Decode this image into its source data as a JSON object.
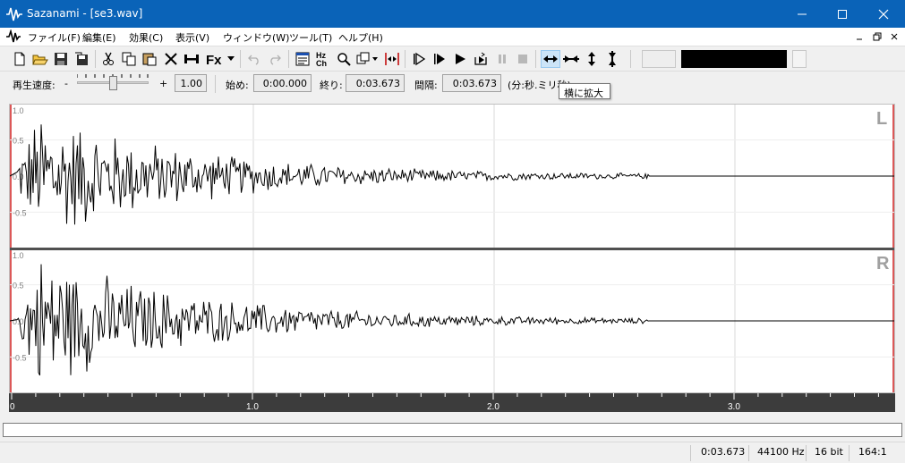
{
  "window": {
    "title": "Sazanami - [se3.wav]"
  },
  "menu": {
    "items": [
      "ファイル(F)",
      "編集(E)",
      "効果(C)",
      "表示(V)",
      "ウィンドウ(W)",
      "ツール(T)",
      "ヘルプ(H)"
    ]
  },
  "toolbar": {
    "icons": [
      "new-file-icon",
      "open-folder-icon",
      "save-icon",
      "save-as-icon",
      "cut-icon",
      "copy-icon",
      "paste-icon",
      "delete-icon",
      "trim-icon",
      "effects-fx-icon",
      "dropdown-arrow-icon",
      "undo-icon",
      "redo-icon",
      "properties-icon",
      "sample-rate-channel-icon",
      "zoom-icon",
      "mix-icon",
      "select-range-icon",
      "play-from-start-icon",
      "play-selection-icon",
      "play-icon",
      "loop-play-icon",
      "pause-icon",
      "stop-icon",
      "zoom-horizontal-in-icon",
      "zoom-horizontal-out-icon",
      "zoom-vertical-in-icon",
      "zoom-vertical-out-icon"
    ],
    "colors": {
      "box1": "#eeeeee",
      "box2": "#000000",
      "box3": "#f4f4f4"
    }
  },
  "range": {
    "speed_label": "再生速度:",
    "speed_minus": "-",
    "speed_plus": "+",
    "speed_value": "1.00",
    "start_label": "始め:",
    "start_value": "0:00.000",
    "end_label": "終り:",
    "end_value": "0:03.673",
    "interval_label": "間隔:",
    "interval_value": "0:03.673",
    "unit_label": "(分:秒.ミリ秒)"
  },
  "tooltip": {
    "text": "横に拡大"
  },
  "waveform": {
    "channels": [
      {
        "name": "L",
        "ticks": [
          "1.0",
          "0.5",
          "0.0",
          "-0.5"
        ]
      },
      {
        "name": "R",
        "ticks": [
          "1.0",
          "0.5",
          "0.0",
          "-0.5"
        ]
      }
    ],
    "duration_seconds": 3.673
  },
  "timeline": {
    "labels": [
      "0",
      "1.0",
      "2.0",
      "3.0"
    ]
  },
  "status": {
    "time": "0:03.673",
    "rate": "44100 Hz",
    "bits": "16 bit",
    "zoom": "164:1"
  }
}
